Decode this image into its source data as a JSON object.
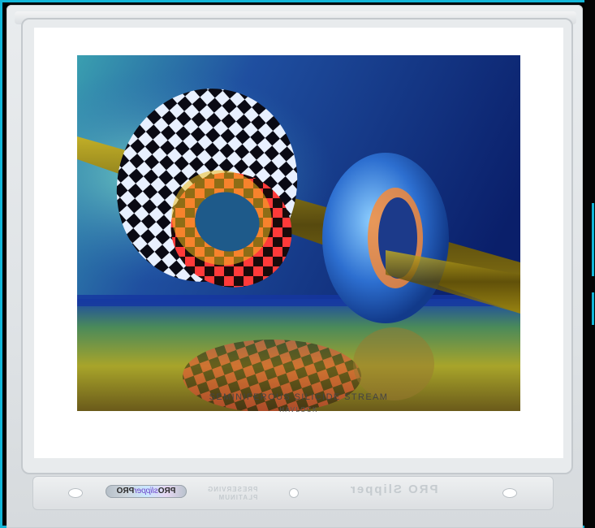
{
  "print": {
    "title": "SEMINIFEROUS SILICIDE STREAM",
    "artist": "HAVLOCK"
  },
  "sleeve": {
    "sticker_brand": "PRO",
    "sticker_accent": "slipper",
    "sticker_suffix": "PRO",
    "embossed_left_top": "PRESERVING",
    "embossed_left_bottom": "PLATINUM",
    "embossed_right": "PRO Slipper"
  },
  "colors": {
    "frame_accent": "#12b6d8",
    "card_background": "#ffffff",
    "caption_text": "#444444"
  },
  "icons": {
    "sleeve_holes": "punch-hole-icon"
  }
}
